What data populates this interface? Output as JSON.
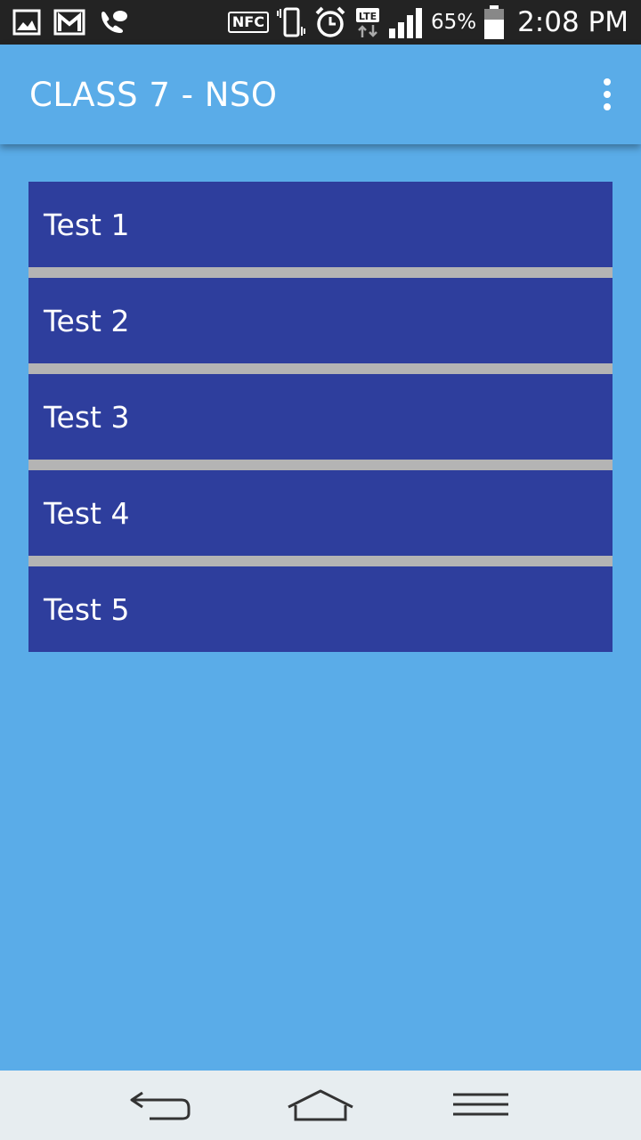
{
  "status_bar": {
    "left_icons": [
      "image-icon",
      "gmail-icon",
      "chat-icon"
    ],
    "nfc_label": "NFC",
    "right_icons": [
      "vibrate-icon",
      "alarm-icon",
      "lte-icon",
      "signal-icon"
    ],
    "battery_percent": "65%",
    "battery_level": 0.65,
    "time": "2:08 PM"
  },
  "app_bar": {
    "title": "CLASS 7 - NSO",
    "menu_icon": "overflow-menu-icon"
  },
  "tests": [
    {
      "label": "Test 1"
    },
    {
      "label": "Test 2"
    },
    {
      "label": "Test 3"
    },
    {
      "label": "Test 4"
    },
    {
      "label": "Test 5"
    }
  ],
  "nav_bar": {
    "buttons": [
      "back-icon",
      "home-icon",
      "menu-icon"
    ]
  },
  "colors": {
    "app_background": "#5aace8",
    "list_item": "#2e3e9d",
    "divider": "#b4b4b4",
    "status_bar": "#232323",
    "nav_bar": "#e7edf0"
  }
}
